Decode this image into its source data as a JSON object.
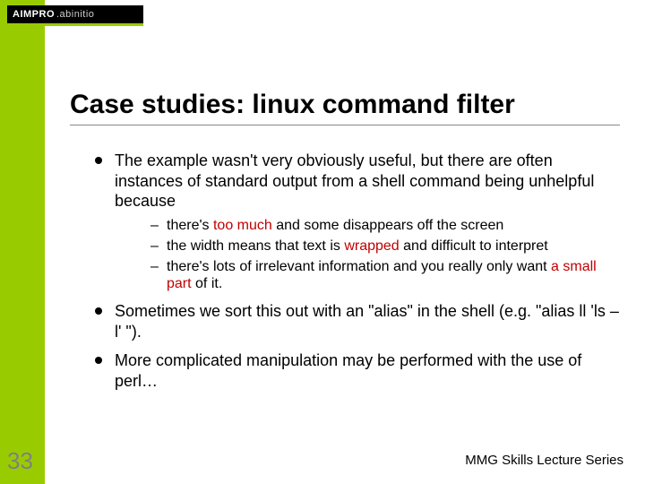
{
  "logo": {
    "brand": "AIMPRO",
    "sub": ".abinitio"
  },
  "title": "Case studies: linux command filter",
  "bullets": [
    {
      "text": "The example wasn't very obviously useful, but there are often instances of standard output from a shell command being unhelpful because",
      "sub": [
        {
          "pre": "there's ",
          "em": "too much",
          "post": " and some disappears off the screen"
        },
        {
          "pre": "the width means that text is ",
          "em": "wrapped",
          "post": " and difficult to interpret"
        },
        {
          "pre": "there's lots of irrelevant information and you really only want ",
          "em": "a small part",
          "post": " of it."
        }
      ]
    },
    {
      "text": "Sometimes we sort this out with an \"alias\" in the shell (e.g. \"alias ll 'ls –l' \")."
    },
    {
      "text": "More complicated manipulation may be performed with the use of perl…"
    }
  ],
  "page_number": "33",
  "footer": "MMG Skills Lecture Series"
}
